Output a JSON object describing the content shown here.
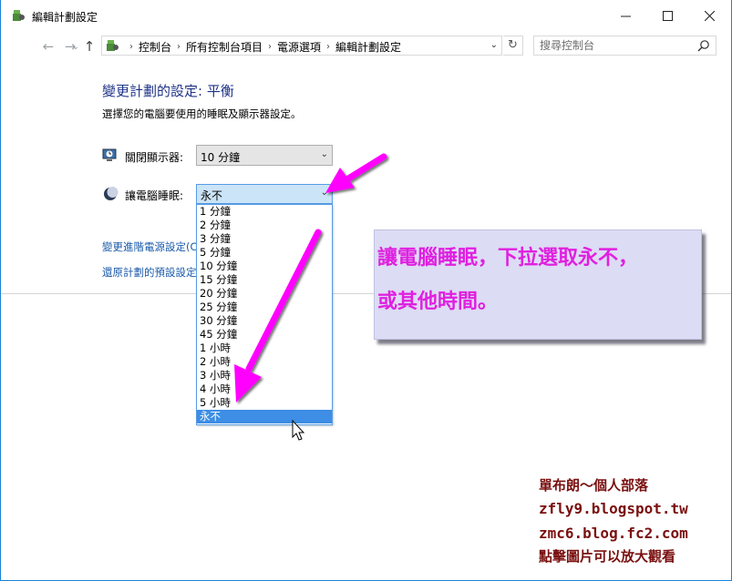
{
  "window": {
    "title": "編輯計劃設定"
  },
  "nav": {
    "breadcrumbs": [
      "控制台",
      "所有控制台項目",
      "電源選項",
      "編輯計劃設定"
    ],
    "search_placeholder": "搜尋控制台"
  },
  "content": {
    "heading": "變更計劃的設定: 平衡",
    "subheading": "選擇您的電腦要使用的睡眠及顯示器設定。",
    "display_label": "關閉顯示器:",
    "display_value": "10 分鐘",
    "sleep_label": "讓電腦睡眠:",
    "sleep_value": "永不",
    "sleep_options": [
      "1 分鐘",
      "2 分鐘",
      "3 分鐘",
      "5 分鐘",
      "10 分鐘",
      "15 分鐘",
      "20 分鐘",
      "25 分鐘",
      "30 分鐘",
      "45 分鐘",
      "1 小時",
      "2 小時",
      "3 小時",
      "4 小時",
      "5 小時",
      "永不"
    ],
    "selected_option_index": 15,
    "link_advanced": "變更進階電源設定(C)",
    "link_restore": "還原計劃的預設設定(R)"
  },
  "annotation": {
    "line1": "讓電腦睡眠，下拉選取永不，",
    "line2": "或其他時間。",
    "arrow_color": "#ff00ff"
  },
  "watermark": {
    "line1": "單布朗～個人部落",
    "line2": "zfly9.blogspot.tw",
    "line3": "zmc6.blog.fc2.com",
    "line4": "點擊圖片可以放大觀看"
  },
  "colors": {
    "heading": "#1e3287",
    "link": "#1a5aa8",
    "selection": "#3d8ee4",
    "callout_text": "#e020e0",
    "watermark": "#7a1010"
  }
}
